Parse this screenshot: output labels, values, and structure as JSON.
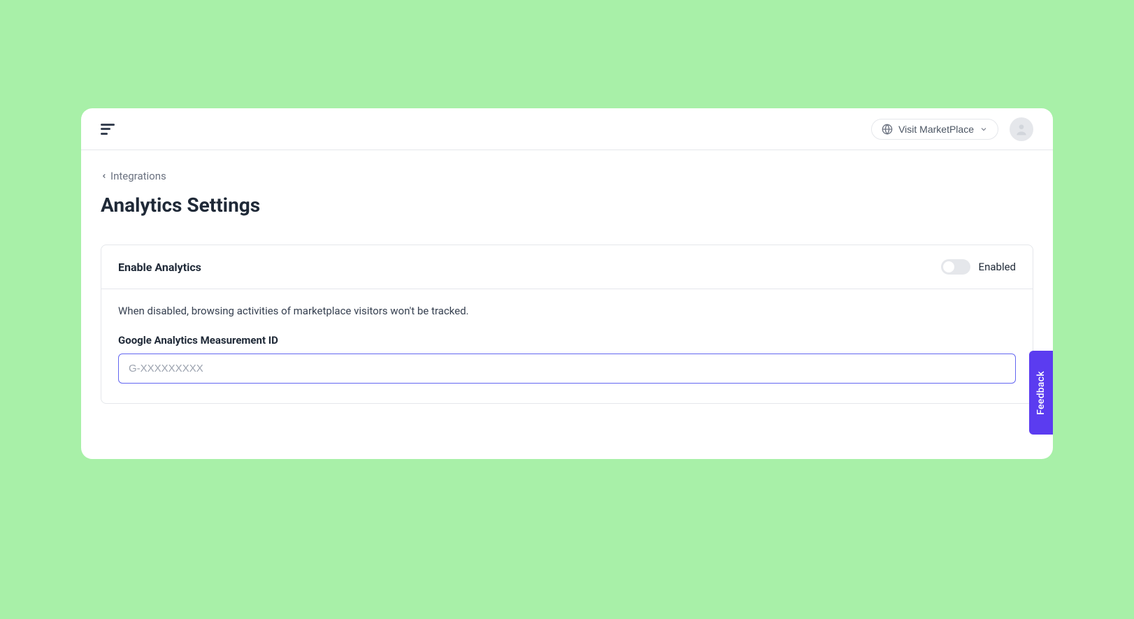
{
  "header": {
    "visit_marketplace_label": "Visit MarketPlace"
  },
  "breadcrumb": {
    "label": "Integrations"
  },
  "page": {
    "title": "Analytics Settings"
  },
  "card": {
    "title": "Enable Analytics",
    "toggle_state": "off",
    "toggle_label": "Enabled",
    "description": "When disabled, browsing activities of marketplace visitors won't be tracked.",
    "measurement_id_label": "Google Analytics Measurement ID",
    "measurement_id_value": "",
    "measurement_id_placeholder": "G-XXXXXXXXX"
  },
  "feedback": {
    "label": "Feedback"
  }
}
